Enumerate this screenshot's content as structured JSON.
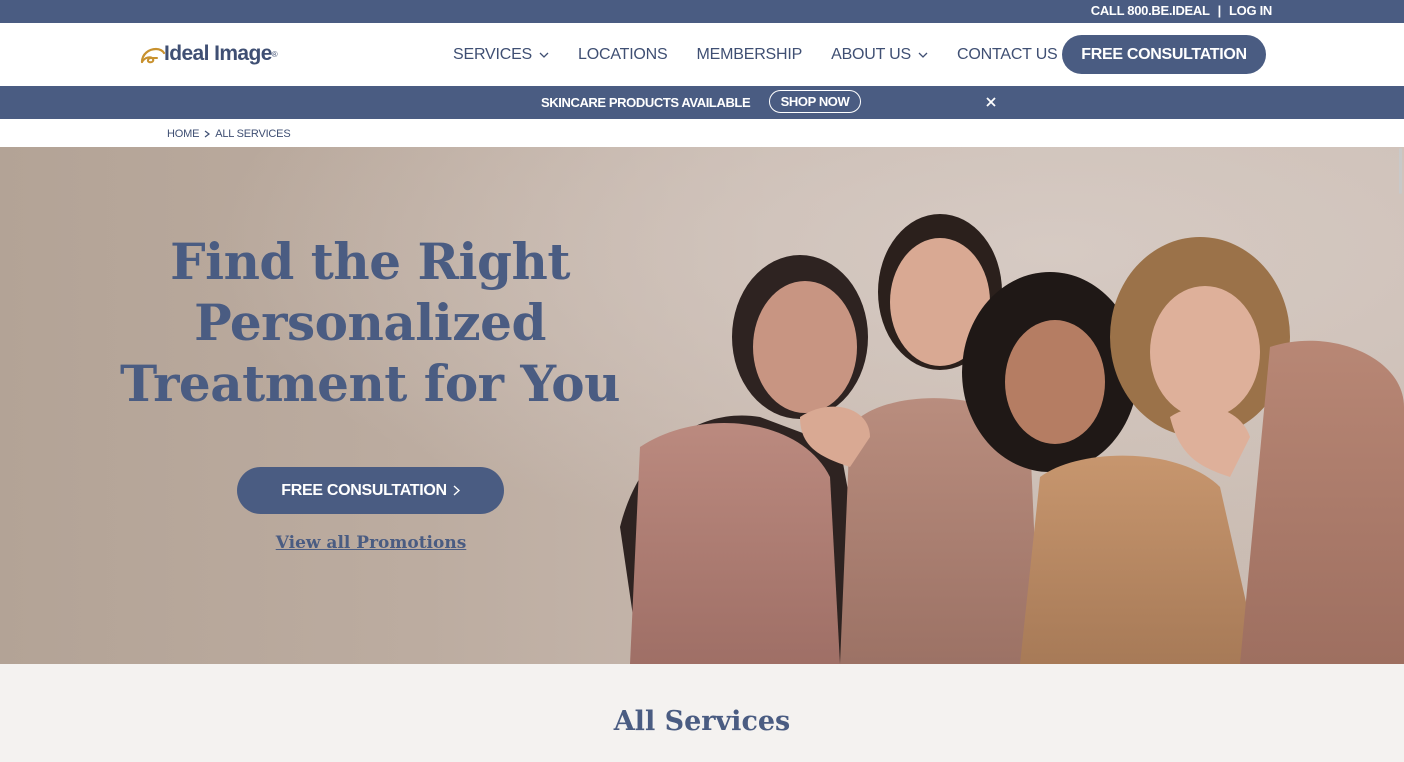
{
  "utility": {
    "call": "CALL 800.BE.IDEAL",
    "separator": "|",
    "login": "LOG IN"
  },
  "brand": {
    "name": "Ideal Image",
    "reg": "®",
    "mark_color": "#c8912e"
  },
  "nav": {
    "items": [
      {
        "label": "SERVICES",
        "has_dropdown": true
      },
      {
        "label": "LOCATIONS",
        "has_dropdown": false
      },
      {
        "label": "MEMBERSHIP",
        "has_dropdown": false
      },
      {
        "label": "ABOUT US",
        "has_dropdown": true
      },
      {
        "label": "CONTACT US",
        "has_dropdown": false
      }
    ],
    "cta": "FREE CONSULTATION"
  },
  "promo": {
    "text": "SKINCARE PRODUCTS AVAILABLE",
    "button": "SHOP NOW",
    "close_icon": "close-icon"
  },
  "breadcrumb": {
    "home": "HOME",
    "current": "ALL SERVICES"
  },
  "hero": {
    "title_lines": [
      "Find the Right",
      "Personalized",
      "Treatment for You"
    ],
    "cta": "FREE CONSULTATION",
    "link": "View all Promotions"
  },
  "services": {
    "title": "All Services"
  },
  "colors": {
    "primary": "#4a5c82",
    "accent": "#c8912e",
    "section_bg": "#f4f2f0",
    "hero_bg": "#c2b3a8"
  }
}
